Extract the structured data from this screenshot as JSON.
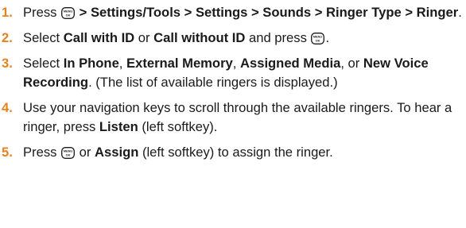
{
  "steps": [
    {
      "number": "1.",
      "t1": "Press ",
      "b1": " > Settings/Tools > Settings > Sounds > Ringer Type > Ringer",
      "t2": "."
    },
    {
      "number": "2.",
      "t1": "Select ",
      "b1": "Call with ID",
      "t2": " or ",
      "b2": "Call without ID",
      "t3": " and press ",
      "t4": "."
    },
    {
      "number": "3.",
      "t1": "Select ",
      "b1": "In Phone",
      "t2": ", ",
      "b2": "External Memory",
      "t3": ", ",
      "b3": "Assigned Media",
      "t4": ", or ",
      "b4": "New Voice Recording",
      "t5": ". (The list of available ringers is displayed.)"
    },
    {
      "number": "4.",
      "t1": "Use your navigation keys to scroll through the available ringers. To hear a ringer, press ",
      "b1": "Listen",
      "t2": " (left softkey)."
    },
    {
      "number": "5.",
      "t1": "Press ",
      "t2": " or ",
      "b1": "Assign",
      "t3": " (left softkey) to assign the ringer."
    }
  ],
  "key_icon": {
    "name": "menu-ok-key-icon",
    "top_text": "MENU",
    "bottom_text": "OK"
  },
  "colors": {
    "step_number": "#e8821e",
    "text": "#1a1a1a"
  }
}
